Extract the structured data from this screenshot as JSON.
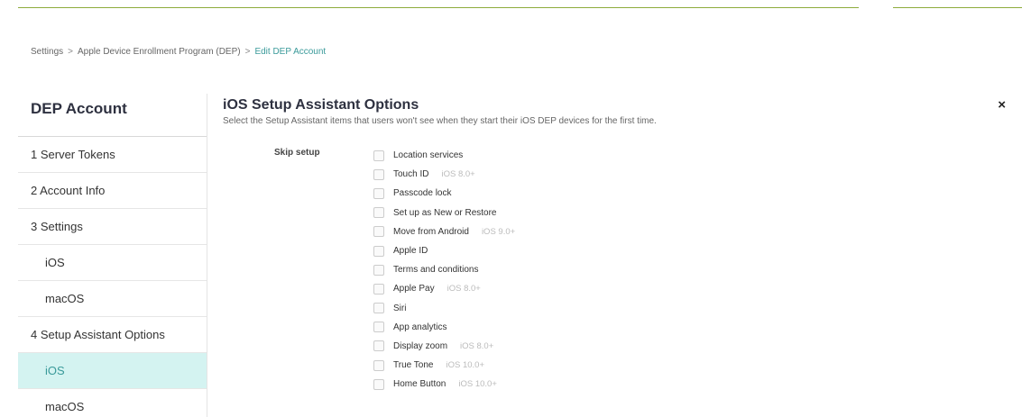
{
  "breadcrumb": {
    "items": [
      "Settings",
      "Apple Device Enrollment Program (DEP)"
    ],
    "separator": ">",
    "current": "Edit DEP Account"
  },
  "sidebar": {
    "title": "DEP Account",
    "items": [
      {
        "label": "1  Server Tokens"
      },
      {
        "label": "2  Account Info"
      },
      {
        "label": "3  Settings"
      },
      {
        "label": "iOS"
      },
      {
        "label": "macOS"
      },
      {
        "label": "4  Setup Assistant Options"
      },
      {
        "label": "iOS",
        "active": true
      },
      {
        "label": "macOS"
      }
    ]
  },
  "close_icon": "×",
  "main": {
    "title": "iOS Setup Assistant Options",
    "description": "Select the Setup Assistant items that users won't see when they start their iOS DEP devices for the first time.",
    "skip_label": "Skip setup",
    "options": [
      {
        "label": "Location services",
        "version": "",
        "checked": false
      },
      {
        "label": "Touch ID",
        "version": "iOS 8.0+",
        "checked": false
      },
      {
        "label": "Passcode lock",
        "version": "",
        "checked": false
      },
      {
        "label": "Set up as New or Restore",
        "version": "",
        "checked": false
      },
      {
        "label": "Move from Android",
        "version": "iOS 9.0+",
        "checked": false
      },
      {
        "label": "Apple ID",
        "version": "",
        "checked": false
      },
      {
        "label": "Terms and conditions",
        "version": "",
        "checked": false
      },
      {
        "label": "Apple Pay",
        "version": "iOS 8.0+",
        "checked": false
      },
      {
        "label": "Siri",
        "version": "",
        "checked": false
      },
      {
        "label": "App analytics",
        "version": "",
        "checked": false
      },
      {
        "label": "Display zoom",
        "version": "iOS 8.0+",
        "checked": false
      },
      {
        "label": "True Tone",
        "version": "iOS 10.0+",
        "checked": false
      },
      {
        "label": "Home Button",
        "version": "iOS 10.0+",
        "checked": false
      }
    ]
  },
  "colors": {
    "accent": "#3a9a9a",
    "active_bg": "#d4f3f1",
    "top_line": "#8dab3c"
  }
}
